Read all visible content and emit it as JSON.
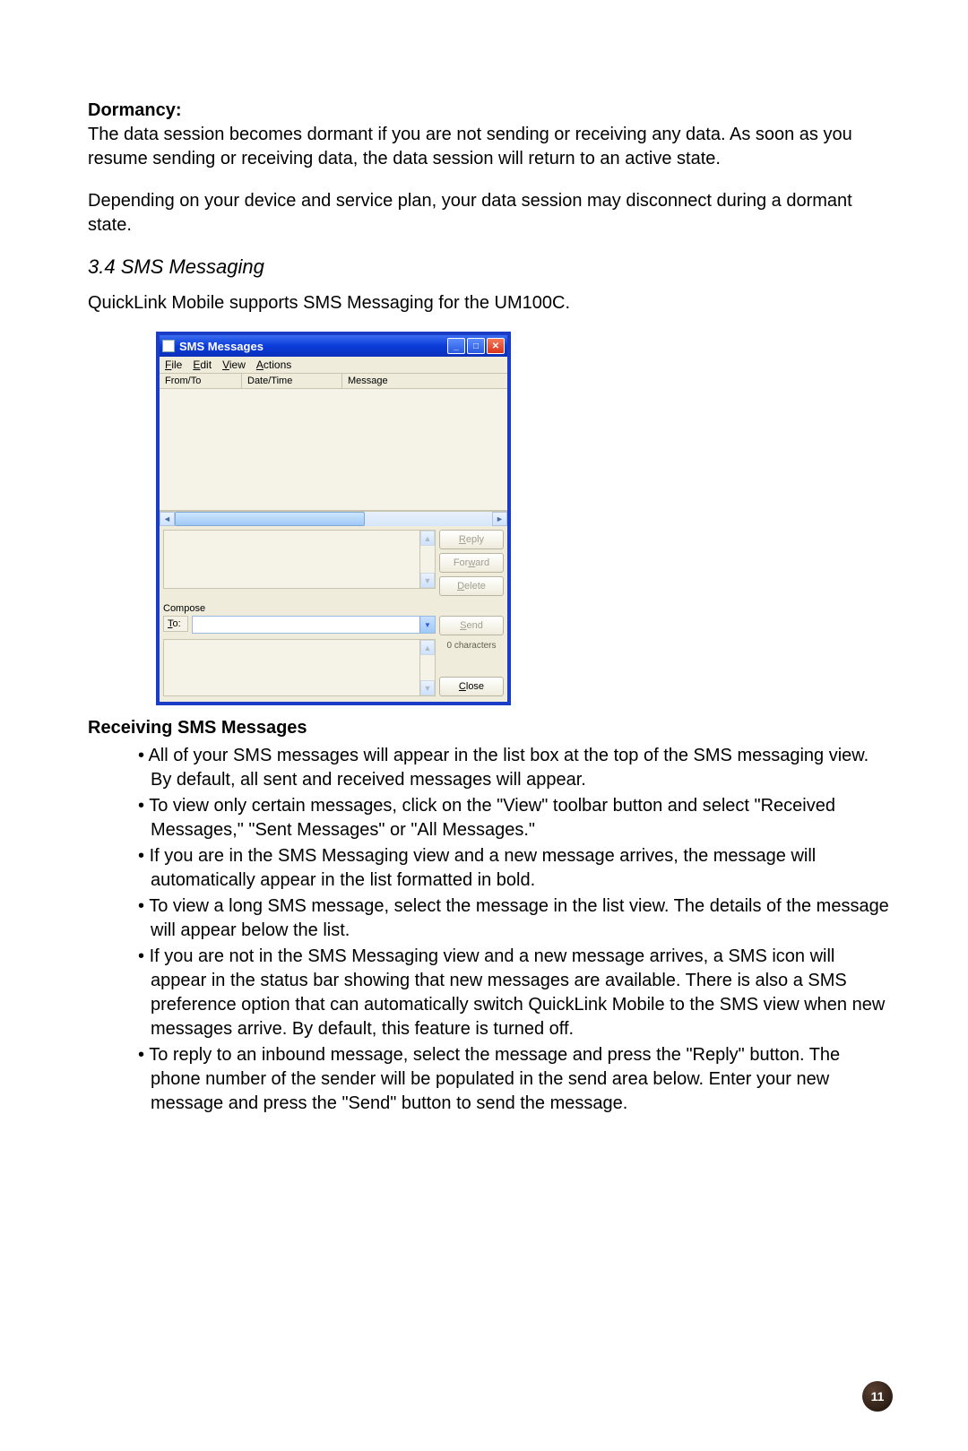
{
  "dormancy": {
    "heading": "Dormancy:",
    "p1": "The data session becomes dormant if you are not sending or receiving any data. As soon as you resume sending or receiving data, the data session will return to an active state.",
    "p2": "Depending on your device and service plan, your data session may disconnect during a dormant state."
  },
  "section_heading": "3.4 SMS Messaging",
  "intro": "QuickLink Mobile supports SMS Messaging for the UM100C.",
  "window": {
    "title": "SMS Messages",
    "menubar": {
      "file": "File",
      "edit": "Edit",
      "view": "View",
      "actions": "Actions"
    },
    "columns": {
      "fromto": "From/To",
      "datetime": "Date/Time",
      "message": "Message"
    },
    "buttons": {
      "reply": "Reply",
      "forward": "Forward",
      "delete": "Delete",
      "send": "Send",
      "close": "Close"
    },
    "compose_label": "Compose",
    "to_label": "To:",
    "char_count": "0 characters"
  },
  "receiving": {
    "heading": "Receiving SMS Messages",
    "bullets": [
      "All of your SMS messages will appear in the list box at the top of the SMS messaging view. By default, all sent and received messages will appear.",
      "To view only certain messages, click on the \"View\" toolbar button and select \"Received Messages,\" \"Sent Messages\" or \"All Messages.\"",
      "If you are in the SMS Messaging view and a new message arrives, the message will automatically appear in the list formatted in bold.",
      "To view a long SMS message, select the message in the list view. The details of the message will appear below the list.",
      "If you are not in the SMS Messaging view and a new message arrives, a SMS icon will appear in the status bar showing that new messages are available. There is also a SMS preference option that can automatically switch QuickLink Mobile to the SMS view when new messages arrive. By default, this feature is turned off.",
      "To reply to an inbound message, select the message and press the \"Reply\" button. The phone number of the sender will be populated in the send area below. Enter your new message and press the \"Send\" button to send the message."
    ]
  },
  "page_number": "11"
}
